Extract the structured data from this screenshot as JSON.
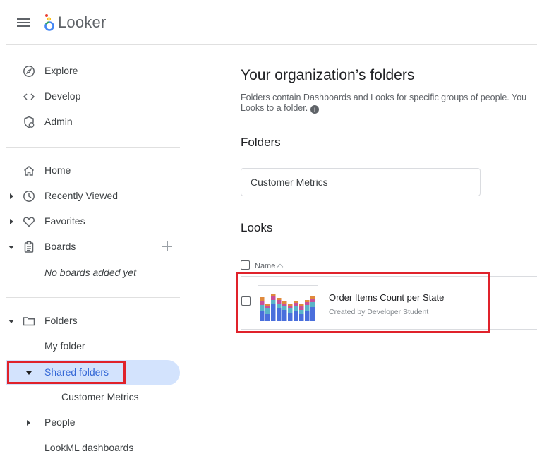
{
  "app": {
    "name": "Looker"
  },
  "sidebar": {
    "top_items": [
      {
        "label": "Explore",
        "icon": "compass-icon"
      },
      {
        "label": "Develop",
        "icon": "code-icon"
      },
      {
        "label": "Admin",
        "icon": "admin-shield-icon"
      }
    ],
    "home_label": "Home",
    "recently_viewed_label": "Recently Viewed",
    "favorites_label": "Favorites",
    "boards_label": "Boards",
    "boards_empty": "No boards added yet",
    "folders_label": "Folders",
    "my_folder_label": "My folder",
    "shared_folders_label": "Shared folders",
    "customer_metrics_label": "Customer Metrics",
    "people_label": "People",
    "lookml_dashboards_label": "LookML dashboards"
  },
  "main": {
    "title": "Your organization’s folders",
    "description_line1": "Folders contain Dashboards and Looks for specific groups of people. You",
    "description_line2": "Looks to a folder.",
    "folders_heading": "Folders",
    "folders": [
      {
        "name": "Customer Metrics"
      }
    ],
    "looks_heading": "Looks",
    "table": {
      "name_header": "Name",
      "rows": [
        {
          "title": "Order Items Count per State",
          "subtitle": "Created by Developer Student"
        }
      ]
    }
  },
  "colors": {
    "accent_blue": "#3367d6",
    "selected_bg": "#d3e3fd",
    "highlight_red": "#e0222b",
    "thumb_series": [
      "#4a6fdc",
      "#5ab4c8",
      "#c8509a",
      "#e08a3c"
    ]
  }
}
